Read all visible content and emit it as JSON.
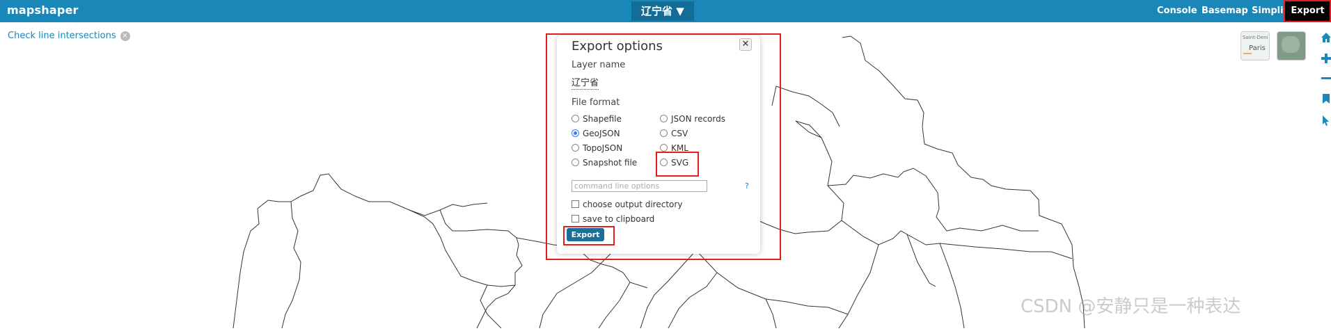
{
  "topbar": {
    "logo": "mapshaper",
    "layer_menu": "辽宁省 ▼",
    "nav": {
      "console": "Console",
      "basemap": "Basemap",
      "simplify": "Simplify",
      "export": "Export"
    }
  },
  "map": {
    "intersections_label": "Check line intersections",
    "intersections_close": "×",
    "basemaps": [
      {
        "label_top": "Saint-Deni",
        "label_main": "Paris"
      },
      {
        "label_main": ""
      }
    ],
    "tools": [
      "home-icon",
      "zoom-in-icon",
      "zoom-out-icon",
      "bookmark-icon",
      "pointer-icon"
    ]
  },
  "export_dialog": {
    "title": "Export options",
    "close": "✕",
    "layer_name_label": "Layer name",
    "layer_name_value": "辽宁省",
    "file_format_label": "File format",
    "formats_left": [
      "Shapefile",
      "GeoJSON",
      "TopoJSON",
      "Snapshot file"
    ],
    "formats_right": [
      "JSON records",
      "CSV",
      "KML",
      "SVG"
    ],
    "selected_format": "GeoJSON",
    "command_placeholder": "command line options",
    "help": "?",
    "choose_dir": "choose output directory",
    "clipboard": "save to clipboard",
    "export_button": "Export"
  },
  "watermark": "CSDN @安静只是一种表达",
  "colors": {
    "topbar": "#1a87b9",
    "accent": "#1a6f9a",
    "highlight": "#e02020"
  }
}
